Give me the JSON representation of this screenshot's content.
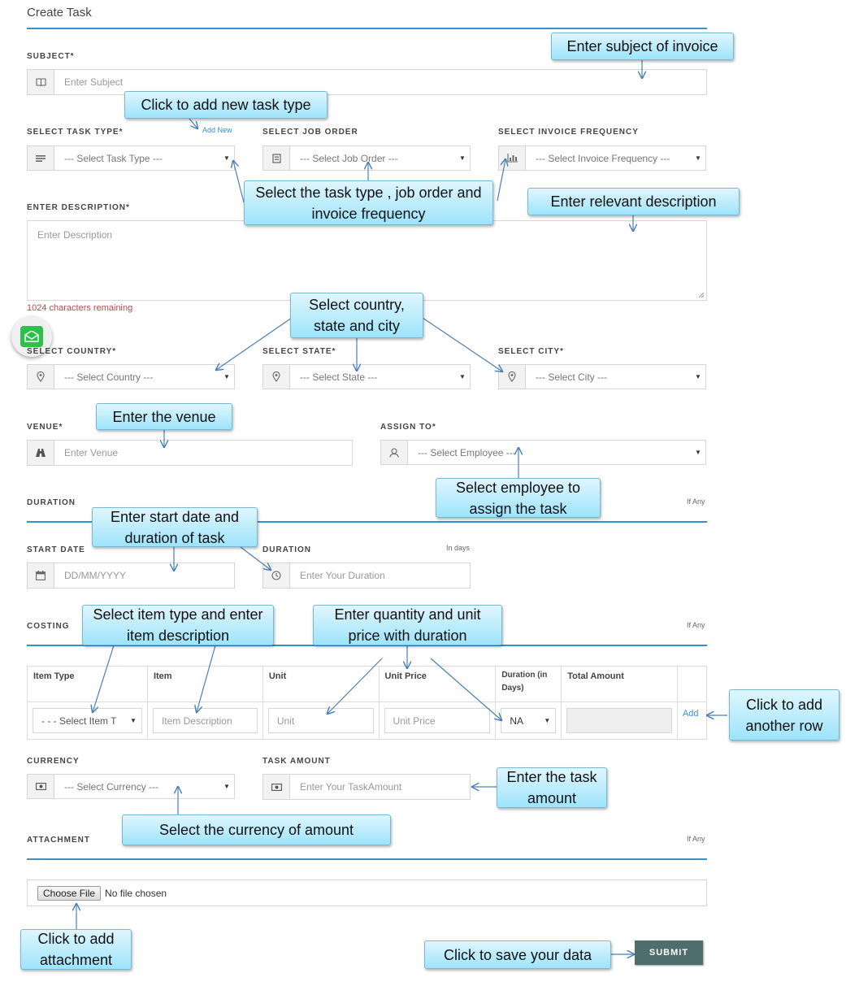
{
  "page": {
    "title": "Create Task"
  },
  "subject": {
    "label": "SUBJECT*",
    "placeholder": "Enter Subject"
  },
  "task_type": {
    "label": "SELECT TASK TYPE*",
    "add_new": "Add New",
    "value": "--- Select Task Type ---"
  },
  "job_order": {
    "label": "SELECT JOB ORDER",
    "value": "--- Select Job Order ---"
  },
  "invoice_frequency": {
    "label": "SELECT INVOICE FREQUENCY",
    "value": "--- Select Invoice Frequency ---"
  },
  "description": {
    "label": "ENTER DESCRIPTION*",
    "placeholder": "Enter Description",
    "counter": "1024 characters remaining"
  },
  "country": {
    "label": "SELECT COUNTRY*",
    "value": "--- Select Country ---"
  },
  "state": {
    "label": "SELECT STATE*",
    "value": "--- Select State ---"
  },
  "city": {
    "label": "SELECT CITY*",
    "value": "--- Select City ---"
  },
  "venue": {
    "label": "VENUE*",
    "placeholder": "Enter Venue"
  },
  "assign_to": {
    "label": "ASSIGN TO*",
    "value": "--- Select Employee ---"
  },
  "duration_section": {
    "title": "DURATION",
    "note": "If Any"
  },
  "start_date": {
    "label": "START DATE",
    "placeholder": "DD/MM/YYYY"
  },
  "duration": {
    "label": "DURATION",
    "note": "In days",
    "placeholder": "Enter Your Duration"
  },
  "costing": {
    "title": "COSTING",
    "note": "If Any",
    "headers": [
      "Item Type",
      "Item",
      "Unit",
      "Unit Price",
      "Duration (in Days)",
      "Total Amount"
    ],
    "row": {
      "item_type": "- - - Select Item T",
      "item_placeholder": "Item Description",
      "unit_placeholder": "Unit",
      "unit_price_placeholder": "Unit Price",
      "duration_value": "NA",
      "add_label": "Add"
    }
  },
  "currency": {
    "label": "CURRENCY",
    "value": "--- Select Currency ---"
  },
  "task_amount": {
    "label": "TASK AMOUNT",
    "placeholder": "Enter Your TaskAmount"
  },
  "attachment": {
    "title": "ATTACHMENT",
    "note": "If Any",
    "button": "Choose File",
    "status": "No file chosen"
  },
  "submit": {
    "label": "SUBMIT"
  },
  "callouts": {
    "subject": "Enter subject of invoice",
    "add_task_type": "Click to add new task type",
    "selects": "Select the task type , job order and invoice frequency",
    "description": "Enter relevant description",
    "location": "Select country, state and city",
    "venue": "Enter the venue",
    "employee": "Select employee to assign the task",
    "dates": "Enter start date and duration of task",
    "item": "Select item type and enter item description",
    "quantity": "Enter quantity and unit price with duration",
    "add_row": "Click to add another row",
    "task_amount": "Enter the task amount",
    "currency": "Select the currency of  amount",
    "attachment": "Click to add attachment",
    "save": "Click to save your data"
  },
  "icons": {
    "subject": "book-icon",
    "task_type": "list-icon",
    "job_order": "document-icon",
    "invoice_frequency": "bar-chart-icon",
    "location": "map-pin-icon",
    "venue": "road-icon",
    "employee": "user-icon",
    "calendar": "calendar-icon",
    "clock": "clock-icon",
    "currency": "money-icon",
    "chat": "chat-icon"
  },
  "colors": {
    "accent": "#3b8fc9",
    "error": "#b84a4a",
    "submit_bg": "#4e6e6e",
    "callout": "#9ee4fb",
    "chat": "#2fbf4b"
  }
}
